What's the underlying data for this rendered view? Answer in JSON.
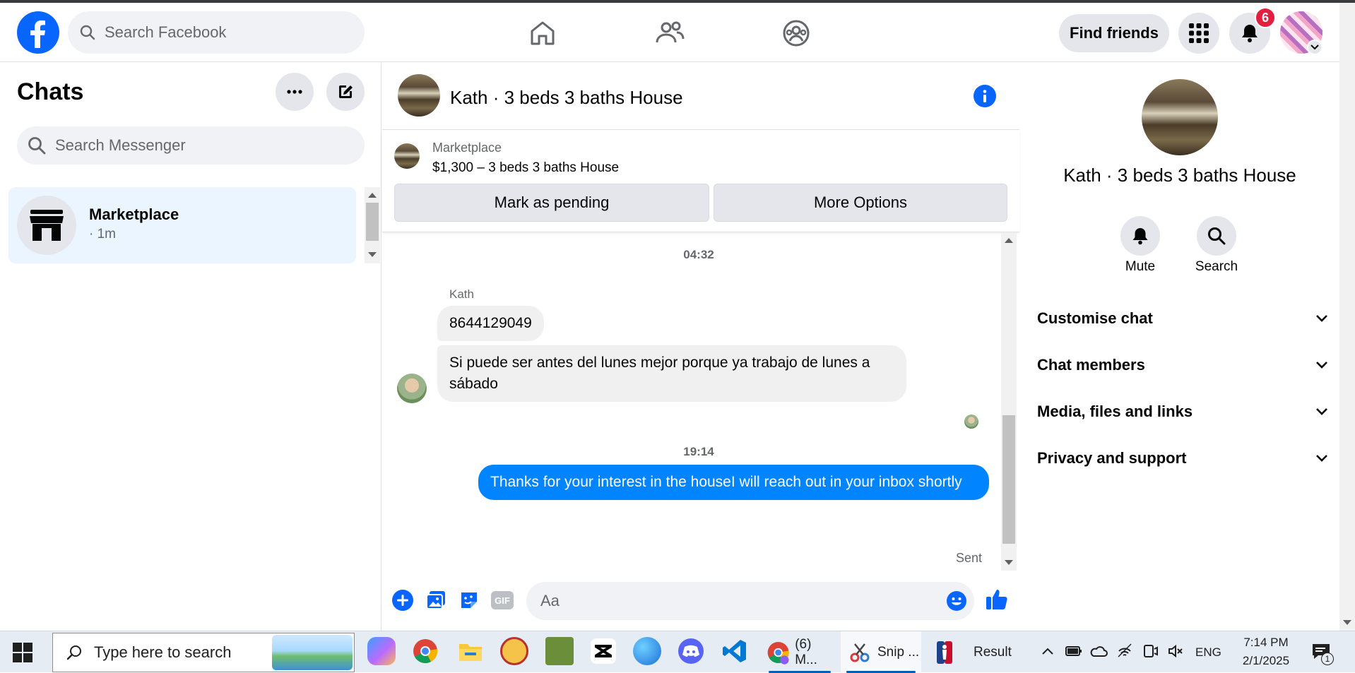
{
  "colors": {
    "brand_blue": "#0866ff",
    "messenger_blue": "#0084ff",
    "badge_red": "#e41e3f",
    "selected_bg": "#ebf5ff"
  },
  "topbar": {
    "search_placeholder": "Search Facebook",
    "nav_icons": [
      "home-icon",
      "friends-icon",
      "groups-icon"
    ],
    "find_friends_label": "Find friends",
    "notifications_count": "6"
  },
  "chats": {
    "title": "Chats",
    "search_placeholder": "Search Messenger",
    "conversations": [
      {
        "name": "Marketplace",
        "time": "· 1m",
        "icon": "storefront-icon"
      }
    ]
  },
  "conversation": {
    "title": "Kath · 3 beds 3 baths House",
    "listing": {
      "source": "Marketplace",
      "title": "$1,300 – 3 beds 3 baths House",
      "mark_pending_label": "Mark as pending",
      "more_options_label": "More Options"
    },
    "messages": {
      "timestamp_1": "04:32",
      "sender": "Kath",
      "incoming_1": "8644129049",
      "incoming_2": "Si puede ser antes del lunes mejor porque ya trabajo de lunes a sábado",
      "timestamp_2": "19:14",
      "outgoing_1": "Thanks for your interest in the houseI will reach out in your inbox shortly",
      "status": "Sent"
    },
    "composer": {
      "placeholder": "Aa",
      "icons": [
        "plus-icon",
        "photo-icon",
        "sticker-icon",
        "gif-icon",
        "emoji-icon",
        "thumbs-up-icon"
      ],
      "gif_label": "GIF"
    }
  },
  "info_panel": {
    "title": "Kath · 3 beds 3 baths House",
    "actions": [
      {
        "label": "Mute",
        "icon": "bell-icon"
      },
      {
        "label": "Search",
        "icon": "search-icon"
      }
    ],
    "sections": [
      "Customise chat",
      "Chat members",
      "Media, files and links",
      "Privacy and support"
    ]
  },
  "taskbar": {
    "search_placeholder": "Type here to search",
    "windows": [
      {
        "label": "(6) M...",
        "app": "chrome-icon"
      },
      {
        "label": "Snip ...",
        "app": "snipping-tool-icon"
      },
      {
        "label": "Result",
        "app": "nba-icon"
      }
    ],
    "language": "ENG",
    "time": "7:14 PM",
    "date": "2/1/2025",
    "notification_count": "1"
  }
}
